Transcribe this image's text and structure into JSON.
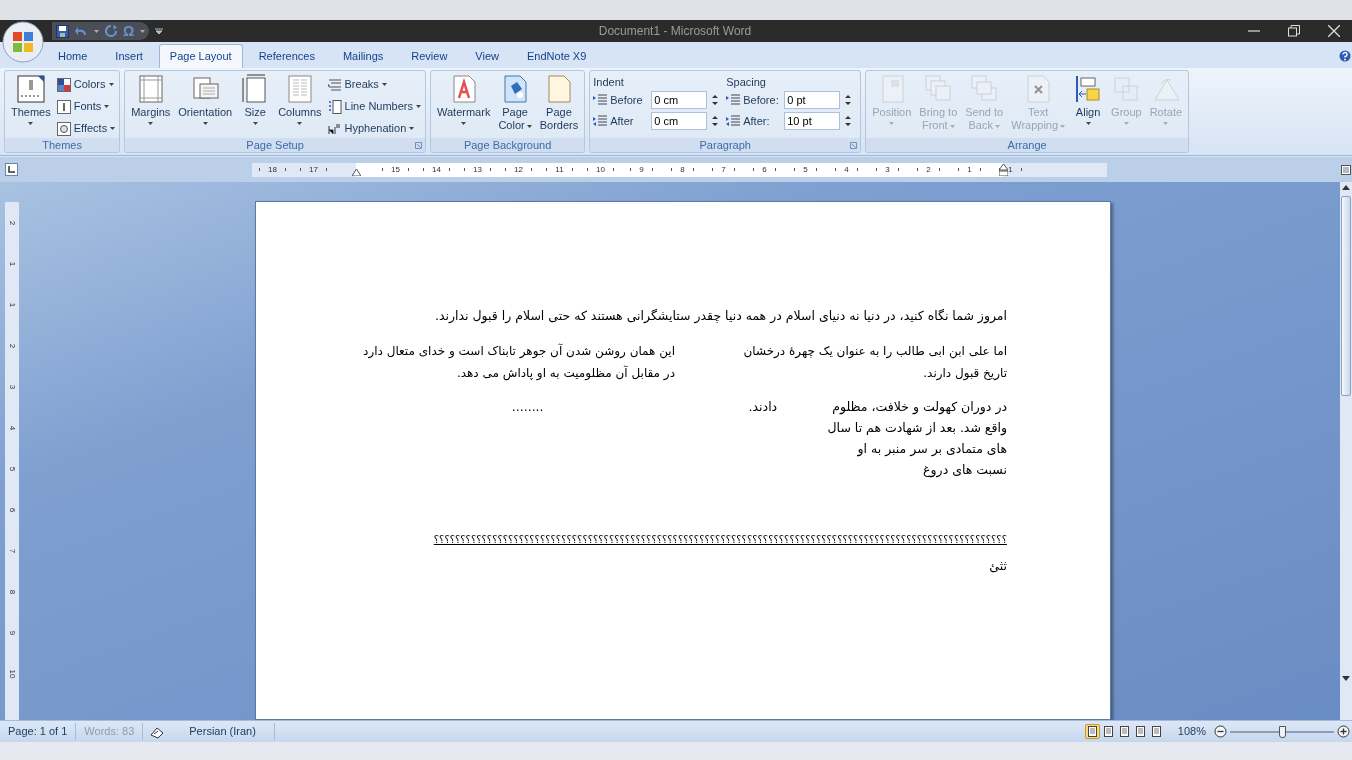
{
  "title_bar": {
    "title": "Document1 - Microsoft Word",
    "symbol_glyph": "Ω"
  },
  "tabs": [
    {
      "label": "Home",
      "selected": false
    },
    {
      "label": "Insert",
      "selected": false
    },
    {
      "label": "Page Layout",
      "selected": true
    },
    {
      "label": "References",
      "selected": false
    },
    {
      "label": "Mailings",
      "selected": false
    },
    {
      "label": "Review",
      "selected": false
    },
    {
      "label": "View",
      "selected": false
    },
    {
      "label": "EndNote X9",
      "selected": false
    }
  ],
  "ribbon": {
    "groups": [
      {
        "label": "Themes",
        "launcher": false,
        "items": [
          {
            "kind": "large",
            "lines": [
              "Themes"
            ],
            "dropdown": true,
            "disabled": false
          },
          {
            "kind": "small",
            "lines": [
              "Colors"
            ],
            "dropdown": true,
            "disabled": false
          },
          {
            "kind": "small",
            "lines": [
              "Fonts"
            ],
            "dropdown": true,
            "disabled": false
          },
          {
            "kind": "small",
            "lines": [
              "Effects"
            ],
            "dropdown": true,
            "disabled": false
          }
        ]
      },
      {
        "label": "Page Setup",
        "launcher": true,
        "items": [
          {
            "kind": "large",
            "lines": [
              "Margins"
            ],
            "dropdown": true,
            "disabled": false
          },
          {
            "kind": "large",
            "lines": [
              "Orientation"
            ],
            "dropdown": true,
            "disabled": false
          },
          {
            "kind": "large",
            "lines": [
              "Size"
            ],
            "dropdown": true,
            "disabled": false
          },
          {
            "kind": "large",
            "lines": [
              "Columns"
            ],
            "dropdown": true,
            "disabled": false
          },
          {
            "kind": "small",
            "lines": [
              "Breaks"
            ],
            "dropdown": true,
            "disabled": false
          },
          {
            "kind": "small",
            "lines": [
              "Line Numbers"
            ],
            "dropdown": true,
            "disabled": false
          },
          {
            "kind": "small",
            "lines": [
              "Hyphenation"
            ],
            "dropdown": true,
            "disabled": false
          }
        ]
      },
      {
        "label": "Page Background",
        "launcher": false,
        "items": [
          {
            "kind": "large",
            "lines": [
              "Watermark"
            ],
            "dropdown": true,
            "disabled": false
          },
          {
            "kind": "large",
            "lines": [
              "Page",
              "Color"
            ],
            "dropdown": true,
            "disabled": false
          },
          {
            "kind": "large",
            "lines": [
              "Page",
              "Borders"
            ],
            "dropdown": false,
            "disabled": false
          }
        ]
      },
      {
        "label": "Paragraph",
        "launcher": true,
        "items": [
          {
            "kind": "fields",
            "heading": "Indent",
            "rows": [
              {
                "label": "Before",
                "value": "0 cm"
              },
              {
                "label": "After",
                "value": "0 cm"
              }
            ]
          },
          {
            "kind": "fields",
            "heading": "Spacing",
            "rows": [
              {
                "label": "Before:",
                "value": "0 pt"
              },
              {
                "label": "After:",
                "value": "10 pt"
              }
            ]
          }
        ]
      },
      {
        "label": "Arrange",
        "launcher": false,
        "items": [
          {
            "kind": "large",
            "lines": [
              "Position"
            ],
            "dropdown": true,
            "disabled": true
          },
          {
            "kind": "large",
            "lines": [
              "Bring to",
              "Front"
            ],
            "dropdown": true,
            "disabled": true
          },
          {
            "kind": "large",
            "lines": [
              "Send to",
              "Back"
            ],
            "dropdown": true,
            "disabled": true
          },
          {
            "kind": "large",
            "lines": [
              "Text",
              "Wrapping"
            ],
            "dropdown": true,
            "disabled": true
          },
          {
            "kind": "large",
            "lines": [
              "Align"
            ],
            "dropdown": true,
            "disabled": false
          },
          {
            "kind": "large",
            "lines": [
              "Group"
            ],
            "dropdown": true,
            "disabled": true
          },
          {
            "kind": "large",
            "lines": [
              "Rotate"
            ],
            "dropdown": true,
            "disabled": true
          }
        ]
      }
    ]
  },
  "ruler": {
    "numbers": [
      "18",
      "17",
      "15",
      "14",
      "13",
      "12",
      "11",
      "10",
      "9",
      "8",
      "7",
      "6",
      "5",
      "4",
      "3",
      "2",
      "1",
      "1"
    ]
  },
  "vertical_ruler": {
    "numbers": [
      "2",
      "1",
      "1",
      "2",
      "3",
      "4",
      "5",
      "6",
      "7",
      "8",
      "9",
      "10"
    ]
  },
  "document": {
    "blocks": [
      {
        "kind": "paragraph",
        "text": "امروز شما نگاه کنید، در دنیا نه دنیای اسلام در همه دنیا چقدر ستایشگرانی هستند که حتی اسلام را قبول ندارند."
      },
      {
        "kind": "columns",
        "columns": [
          "اما علی ابن ابی طالب را به عنوان یک چهرهٔ درخشان تاریخ قبول دارند.",
          "این همان روشن شدن آن جوهر تابناک است و خدای متعال دارد در مقابل آن مظلومیت به او پاداش می دهد."
        ]
      },
      {
        "kind": "spaced",
        "parts": [
          "در دوران کهولت و خلافت، مظلوم",
          "دادند.",
          "........"
        ],
        "lines": [
          "واقع شد. بعد از شهادت هم تا سال",
          "های متمادی بر سر منبر به او",
          "نسبت های دروغ"
        ]
      },
      {
        "kind": "underlined",
        "text": "؟؟؟؟؟؟؟؟؟؟؟؟؟؟؟؟؟؟؟؟؟؟؟؟؟؟؟؟؟؟؟؟؟؟؟؟؟؟؟؟؟؟؟؟؟؟؟؟؟؟؟؟؟؟؟؟؟؟؟؟؟؟؟؟؟؟؟؟؟؟؟؟؟؟؟؟؟؟؟؟؟؟؟؟؟؟؟؟؟؟؟؟؟؟؟؟؟؟؟؟؟؟؟؟؟؟؟؟"
      },
      {
        "kind": "paragraph",
        "text": "ثثئ"
      }
    ]
  },
  "status_bar": {
    "page": "Page: 1 of 1",
    "words": "Words: 83",
    "words_disabled": true,
    "language": "Persian (Iran)",
    "view_buttons": [
      {
        "selected": true
      },
      {
        "selected": false
      },
      {
        "selected": false
      },
      {
        "selected": false
      },
      {
        "selected": false
      }
    ],
    "zoom": "108%",
    "zoom_slider": {
      "level": 0.5
    }
  }
}
